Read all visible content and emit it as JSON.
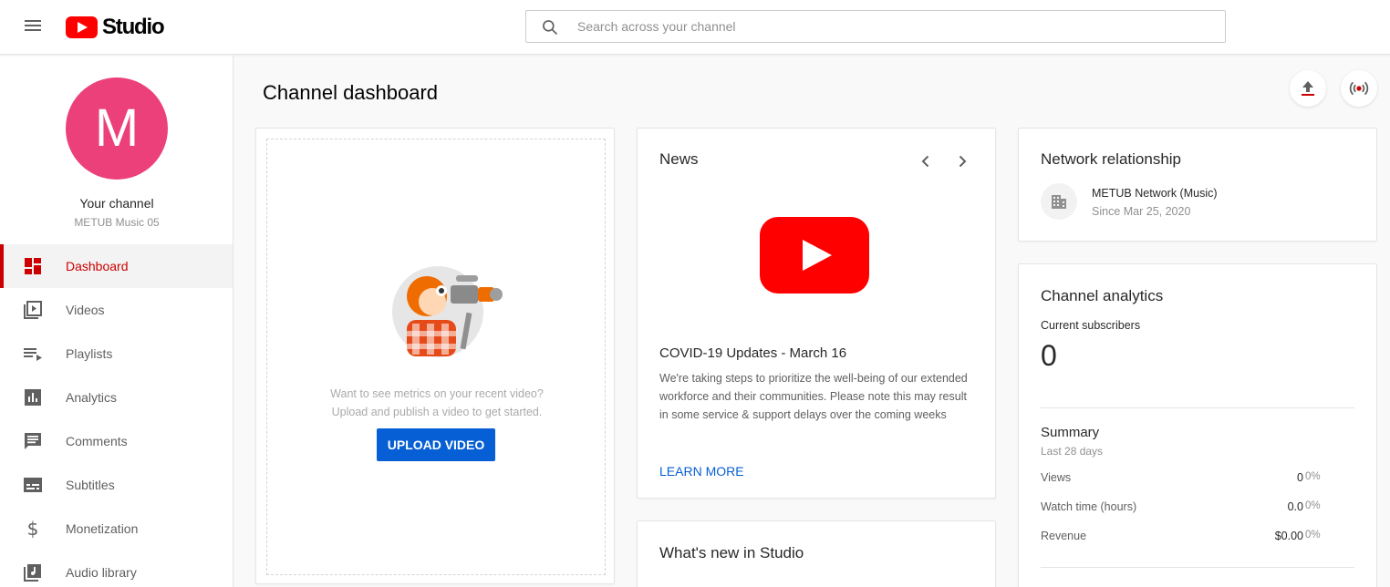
{
  "header": {
    "menu_icon": "hamburger-icon",
    "logo_text": "Studio",
    "search_placeholder": "Search across your channel"
  },
  "sidebar": {
    "avatar_letter": "M",
    "avatar_color": "#ec407a",
    "channel_title": "Your channel",
    "channel_name": "METUB Music 05",
    "items": [
      {
        "label": "Dashboard",
        "icon": "dashboard-icon",
        "active": true
      },
      {
        "label": "Videos",
        "icon": "videos-icon"
      },
      {
        "label": "Playlists",
        "icon": "playlists-icon"
      },
      {
        "label": "Analytics",
        "icon": "analytics-icon"
      },
      {
        "label": "Comments",
        "icon": "comments-icon"
      },
      {
        "label": "Subtitles",
        "icon": "subtitles-icon"
      },
      {
        "label": "Monetization",
        "icon": "monetization-icon"
      },
      {
        "label": "Audio library",
        "icon": "audio-library-icon"
      }
    ]
  },
  "main": {
    "page_title": "Channel dashboard",
    "actions": [
      "upload-icon",
      "go-live-icon"
    ]
  },
  "video_card": {
    "empty_text_1": "Want to see metrics on your recent video?",
    "empty_text_2": "Upload and publish a video to get started.",
    "upload_button": "UPLOAD VIDEO"
  },
  "news": {
    "title": "News",
    "headline": "COVID-19 Updates - March 16",
    "body": "We're taking steps to prioritize the well-being of our extended workforce and their communities. Please note this may result in some service & support delays over the coming weeks",
    "link": "LEARN MORE"
  },
  "whats_new": {
    "title": "What's new in Studio"
  },
  "network": {
    "title": "Network relationship",
    "name": "METUB Network (Music)",
    "since": "Since Mar 25, 2020"
  },
  "analytics": {
    "title": "Channel analytics",
    "subscribers_label": "Current subscribers",
    "subscribers_value": "0",
    "summary_title": "Summary",
    "summary_period": "Last 28 days",
    "metrics": [
      {
        "label": "Views",
        "value": "0",
        "pct": "0%"
      },
      {
        "label": "Watch time (hours)",
        "value": "0.0",
        "pct": "0%"
      },
      {
        "label": "Revenue",
        "value": "$0.00",
        "pct": "0%"
      }
    ]
  },
  "colors": {
    "brand_red": "#ff0000",
    "active_red": "#cc0000",
    "link_blue": "#065fd4"
  }
}
